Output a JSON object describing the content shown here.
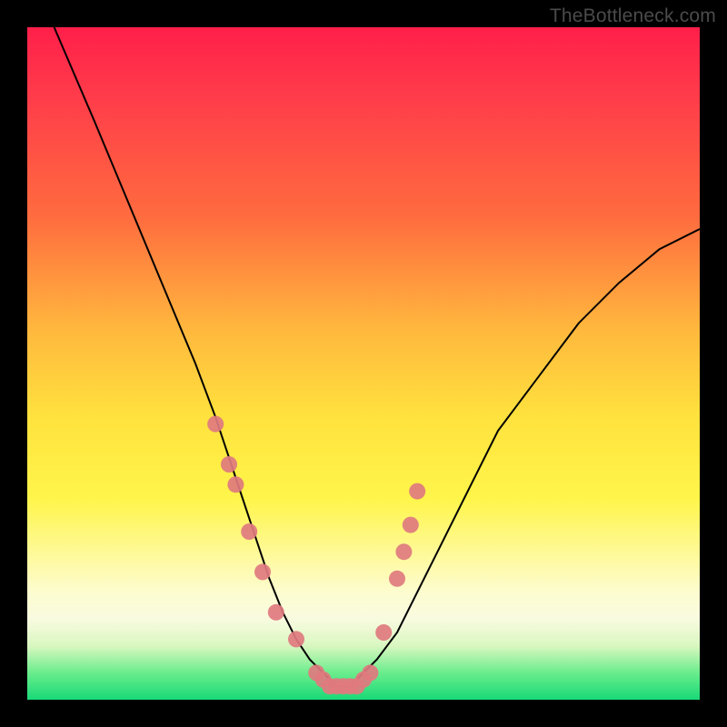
{
  "watermark": "TheBottleneck.com",
  "chart_data": {
    "type": "line",
    "title": "",
    "xlabel": "",
    "ylabel": "",
    "xlim": [
      0,
      100
    ],
    "ylim": [
      0,
      100
    ],
    "grid": false,
    "series": [
      {
        "name": "curve",
        "x": [
          4,
          10,
          15,
          20,
          25,
          28,
          30,
          32,
          34,
          36,
          38,
          40,
          42,
          44,
          45,
          46,
          47,
          48,
          49,
          50,
          52,
          55,
          58,
          62,
          66,
          70,
          76,
          82,
          88,
          94,
          100
        ],
        "values": [
          100,
          86,
          74,
          62,
          50,
          42,
          36,
          30,
          24,
          18,
          13,
          9,
          6,
          4,
          3,
          2,
          2,
          2,
          3,
          4,
          6,
          10,
          16,
          24,
          32,
          40,
          48,
          56,
          62,
          67,
          70
        ]
      }
    ],
    "markers": {
      "name": "dots",
      "x": [
        28,
        30,
        31,
        33,
        35,
        37,
        40,
        43,
        44,
        45,
        46,
        47,
        48,
        49,
        50,
        51,
        53,
        55,
        56,
        57,
        58
      ],
      "values": [
        41,
        35,
        32,
        25,
        19,
        13,
        9,
        4,
        3,
        2,
        2,
        2,
        2,
        2,
        3,
        4,
        10,
        18,
        22,
        26,
        31
      ],
      "color": "#e07a7f",
      "radius_px": 9
    },
    "gradient_note": "Background encodes bottleneck severity: red=high, green=low"
  }
}
